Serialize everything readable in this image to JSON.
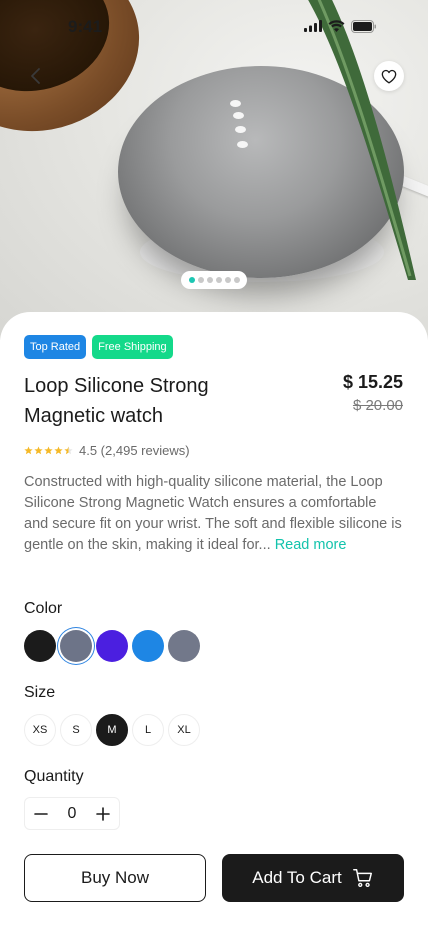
{
  "status_bar": {
    "time": "9:41"
  },
  "hero": {
    "slide_count": 6,
    "active_slide": 0
  },
  "badges": [
    {
      "label": "Top Rated",
      "color": "#1e86e4"
    },
    {
      "label": "Free Shipping",
      "color": "#14d98a"
    }
  ],
  "product": {
    "title": "Loop Silicone Strong Magnetic watch",
    "price": "$ 15.25",
    "old_price": "$ 20.00",
    "rating_value": 4.5,
    "rating_text": "4.5 (2,495 reviews)",
    "description": "Constructed with high-quality silicone material, the Loop Silicone Strong Magnetic Watch ensures a comfortable and secure fit on your wrist. The soft and flexible silicone is gentle on the skin, making it ideal for...",
    "read_more": "Read more"
  },
  "color_section": {
    "label": "Color",
    "swatches": [
      "#1b1b1b",
      "#6d7488",
      "#4b1fe0",
      "#1e86e4",
      "#72788a"
    ],
    "selected_index": 1
  },
  "size_section": {
    "label": "Size",
    "options": [
      "XS",
      "S",
      "M",
      "L",
      "XL"
    ],
    "selected": "M"
  },
  "quantity_section": {
    "label": "Quantity",
    "value": "0"
  },
  "actions": {
    "buy_now": "Buy Now",
    "add_to_cart": "Add To Cart"
  },
  "colors": {
    "accent": "#13c3ac",
    "dark": "#1b1b1b"
  }
}
